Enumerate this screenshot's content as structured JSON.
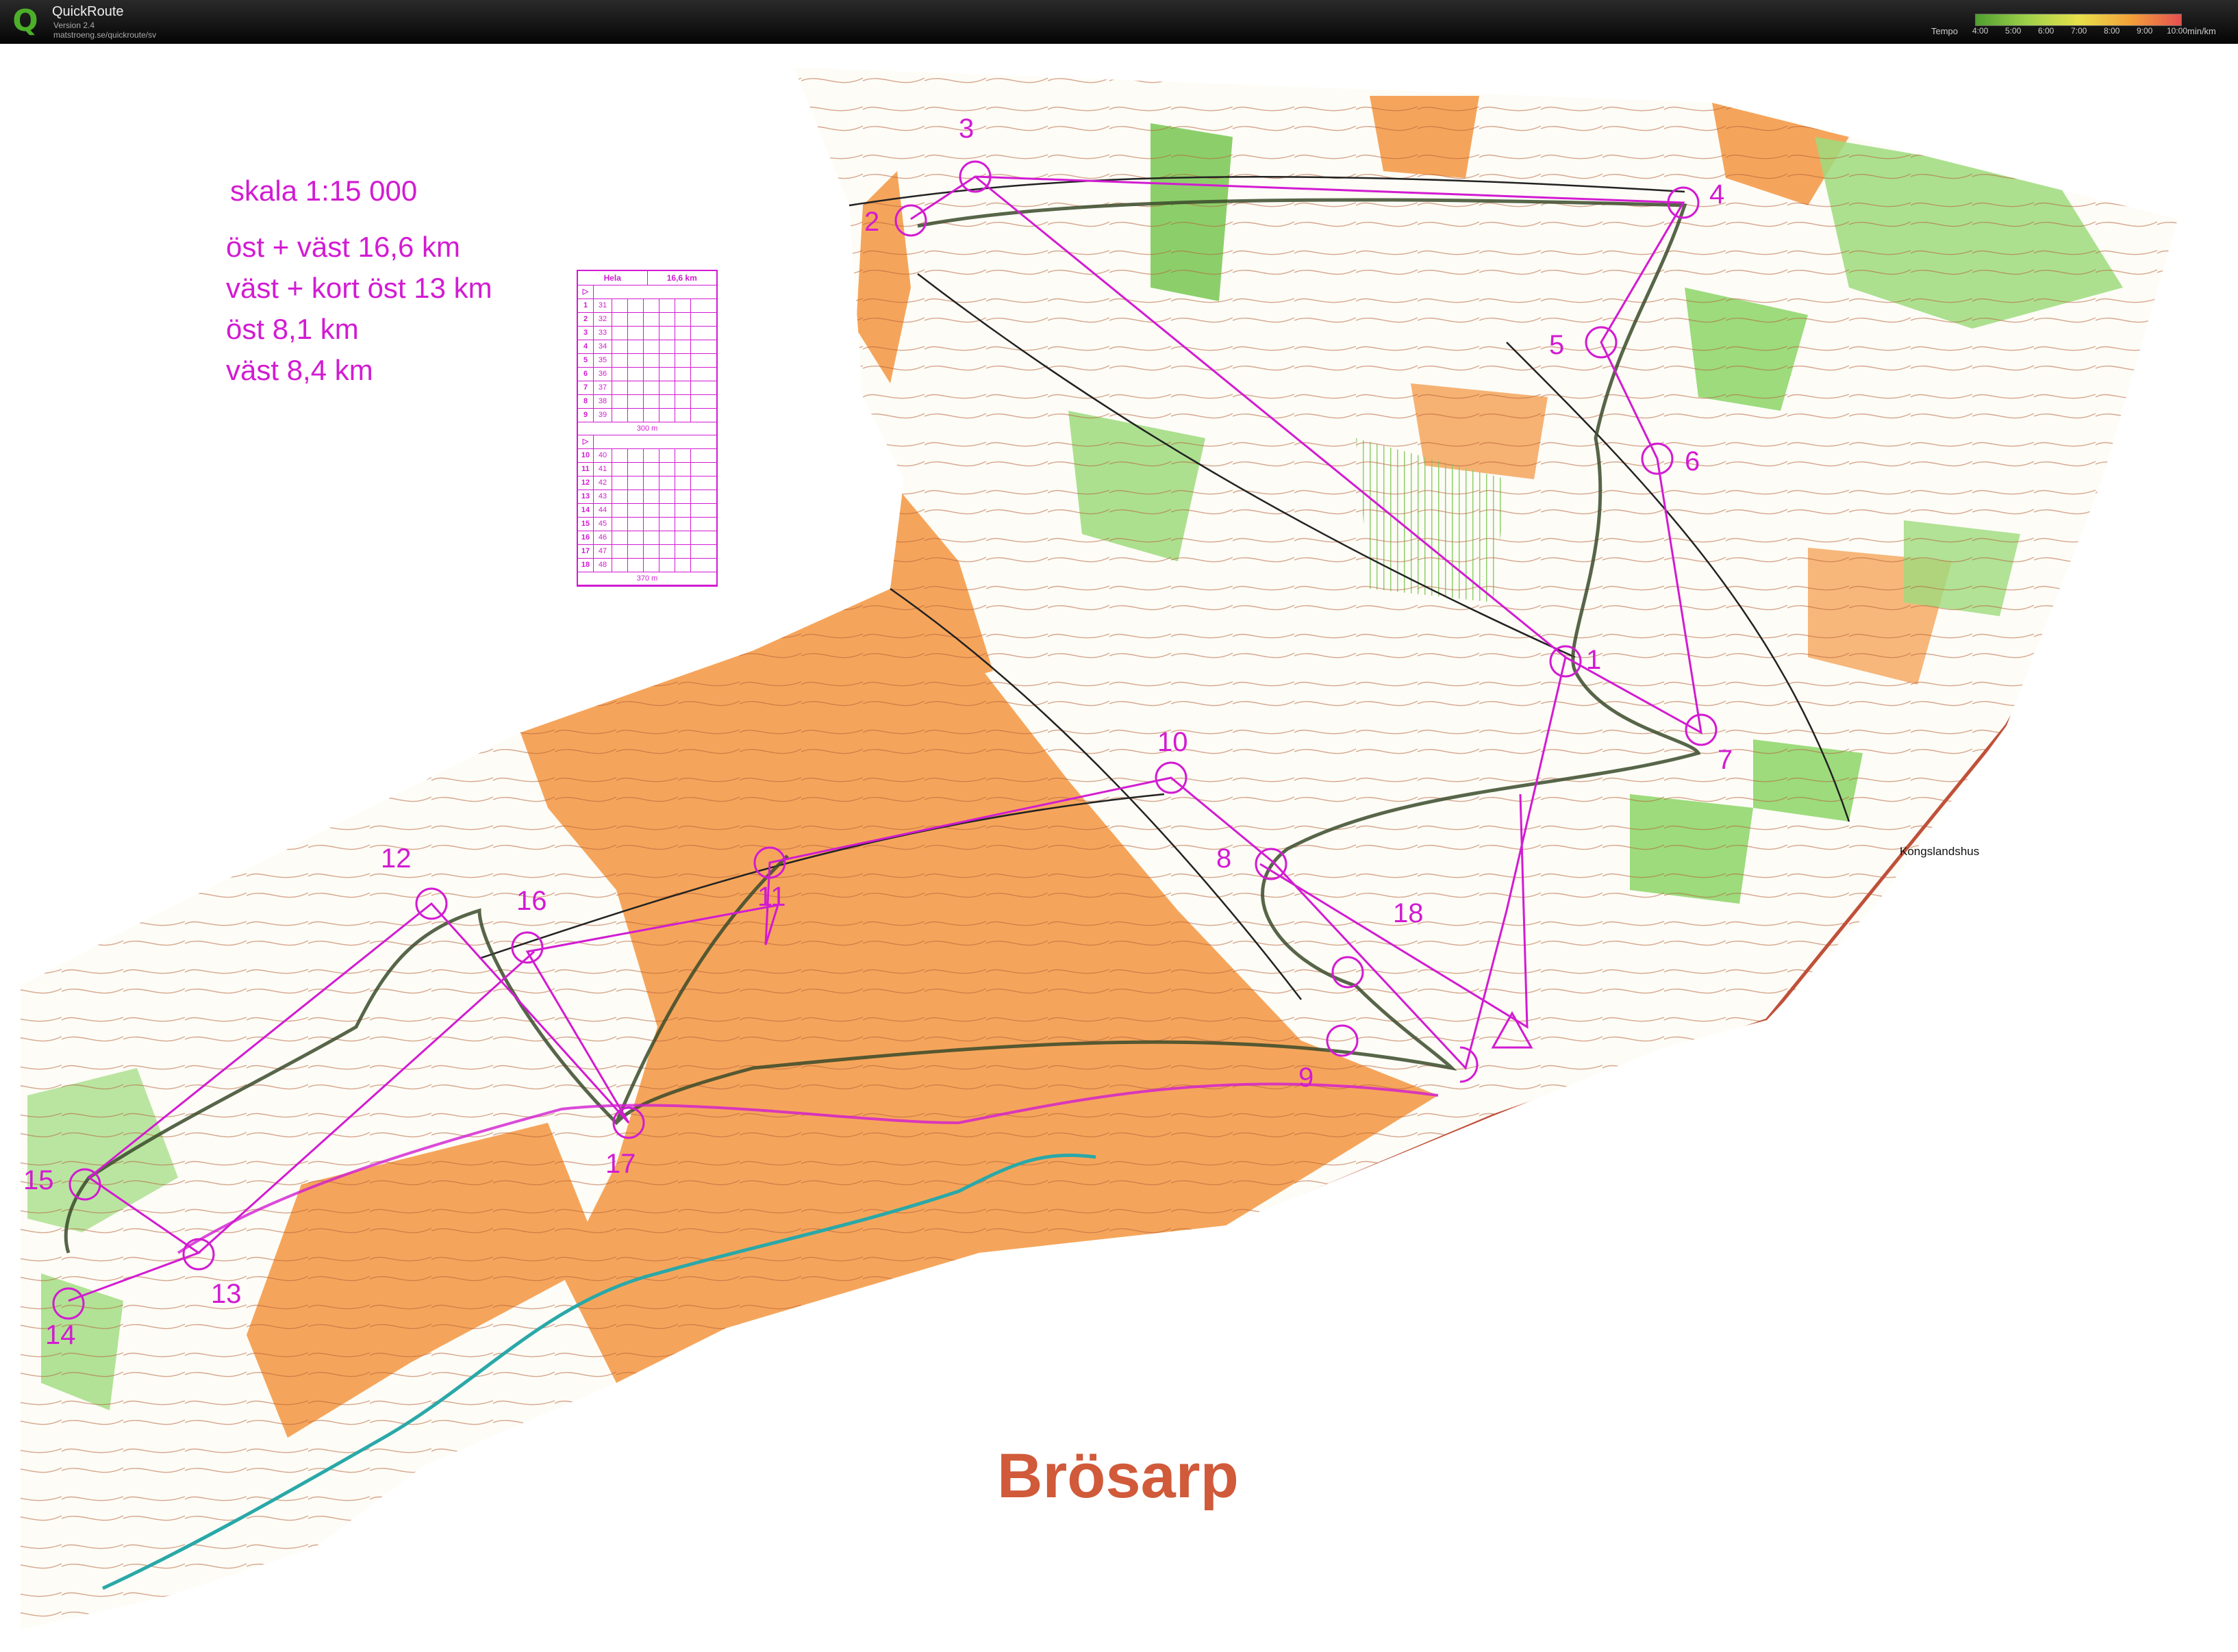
{
  "app": {
    "name": "QuickRoute",
    "version": "Version 2.4",
    "url": "matstroeng.se/quickroute/sv"
  },
  "tempo": {
    "label": "Tempo",
    "ticks": [
      "4:00",
      "5:00",
      "6:00",
      "7:00",
      "8:00",
      "9:00",
      "10:00"
    ],
    "unit": "min/km"
  },
  "map": {
    "title": "Brösarp",
    "place_label": "Kongslandshus",
    "info_lines": [
      "skala 1:15 000",
      "öst + väst 16,6 km",
      "väst + kort öst 13 km",
      "öst 8,1 km",
      "väst 8,4 km"
    ],
    "controls": [
      "2",
      "3",
      "4",
      "5",
      "6",
      "1",
      "7",
      "10",
      "8",
      "18",
      "9",
      "11",
      "12",
      "16",
      "17",
      "15",
      "13",
      "14"
    ],
    "colors": {
      "open_land": "#f5a55b",
      "forest_green": "#9ddb7d",
      "course": "#d21bd2",
      "route": "#3a4a2a",
      "contour": "#b5603a",
      "water": "#2aa8a8"
    },
    "description_sheet": {
      "header": [
        "Hela",
        "16,6 km"
      ],
      "part1": [
        {
          "n": "1",
          "code": "31"
        },
        {
          "n": "2",
          "code": "32"
        },
        {
          "n": "3",
          "code": "33"
        },
        {
          "n": "4",
          "code": "34"
        },
        {
          "n": "5",
          "code": "35"
        },
        {
          "n": "6",
          "code": "36"
        },
        {
          "n": "7",
          "code": "37"
        },
        {
          "n": "8",
          "code": "38"
        },
        {
          "n": "9",
          "code": "39"
        }
      ],
      "part1_distance": "300 m",
      "part2": [
        {
          "n": "10",
          "code": "40"
        },
        {
          "n": "11",
          "code": "41"
        },
        {
          "n": "12",
          "code": "42"
        },
        {
          "n": "13",
          "code": "43"
        },
        {
          "n": "14",
          "code": "44"
        },
        {
          "n": "15",
          "code": "45"
        },
        {
          "n": "16",
          "code": "46"
        },
        {
          "n": "17",
          "code": "47"
        },
        {
          "n": "18",
          "code": "48"
        }
      ],
      "part2_distance": "370 m"
    }
  }
}
